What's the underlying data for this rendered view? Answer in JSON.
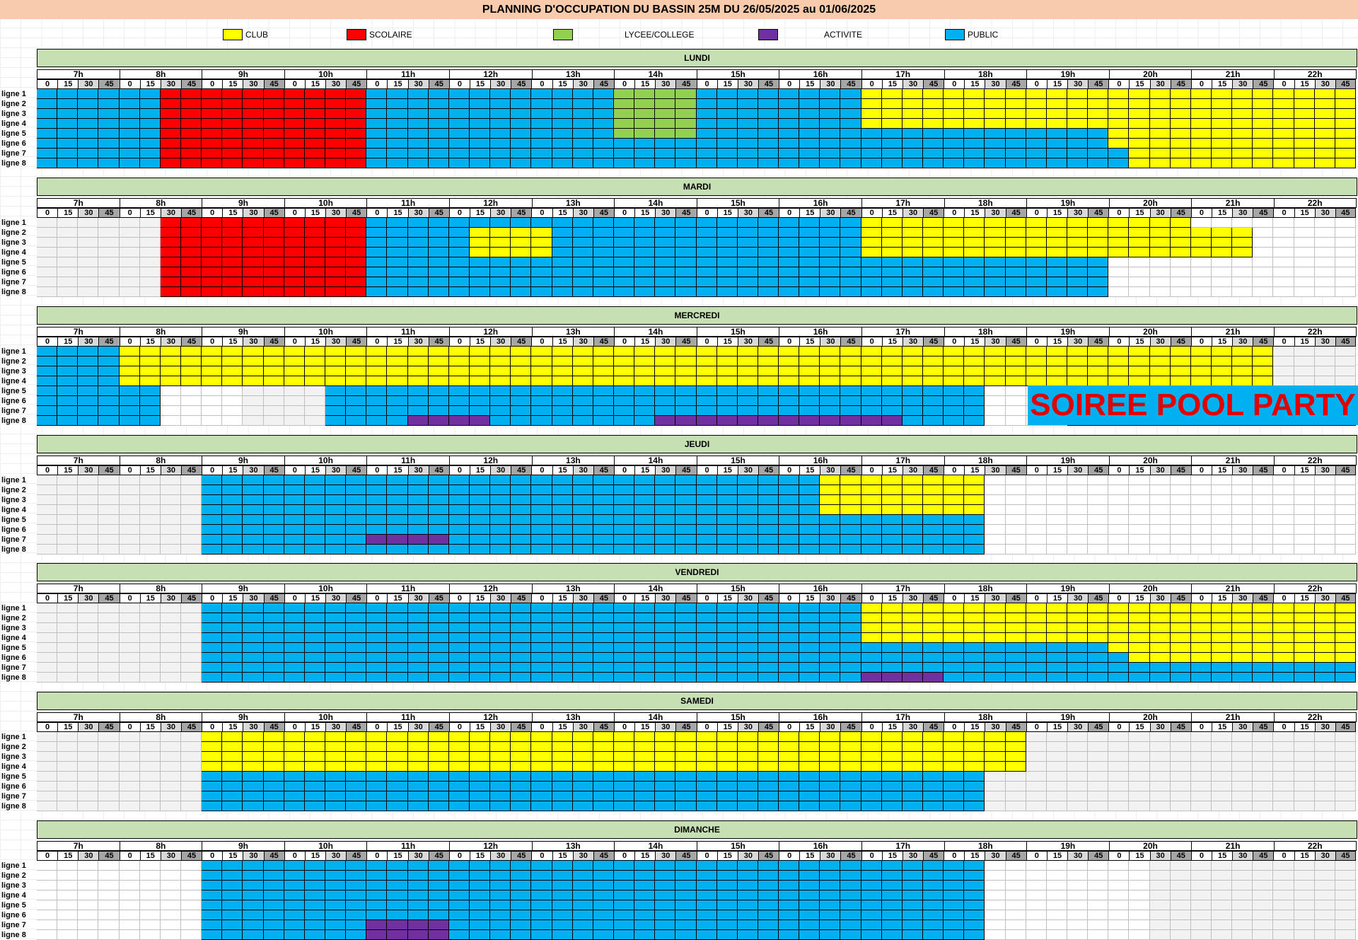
{
  "title": "PLANNING D'OCCUPATION DU BASSIN 25M DU 26/05/2025 au 01/06/2025",
  "legend": [
    {
      "code": "C",
      "label": "CLUB",
      "color": "#FFFF00"
    },
    {
      "code": "S",
      "label": "SCOLAIRE",
      "color": "#FF0000"
    },
    {
      "code": "L",
      "label": "LYCEE/COLLEGE",
      "color": "#92D050"
    },
    {
      "code": "A",
      "label": "ACTIVITE",
      "color": "#7030A0"
    },
    {
      "code": "P",
      "label": "PUBLIC",
      "color": "#00B0F0"
    }
  ],
  "hours": [
    "7h",
    "8h",
    "9h",
    "10h",
    "11h",
    "12h",
    "13h",
    "14h",
    "15h",
    "16h",
    "17h",
    "18h",
    "19h",
    "20h",
    "21h",
    "22h"
  ],
  "quarters": [
    "0",
    "15",
    "30",
    "45"
  ],
  "lines": [
    "ligne 1",
    "ligne 2",
    "ligne 3",
    "ligne 4",
    "ligne 5",
    "ligne 6",
    "ligne 7",
    "ligne 8"
  ],
  "days": [
    {
      "name": "LUNDI",
      "rows": [
        "PPPPPPSSSSSSSSSSPPPPPPPPPPPPLLLLPPPPPPPPCCCCCCCCCCCCCCCCCCCCCCCCnnnnnnnn",
        "PPPPPPSSSSSSSSSSPPPPPPPPPPPPLLLLPPPPPPPPCCCCCCCCCCCCCCCCCCCCCCCCnnnnnnnn",
        "PPPPPPSSSSSSSSSSPPPPPPPPPPPPLLLLPPPPPPPPCCCCCCCCCCCCCCCCCCCCCCCCnnnnnnnn",
        "PPPPPPSSSSSSSSSSPPPPPPPPPPPPLLLLPPPPPPPPCCCCCCCCCCCCCCCCCCCCCCCCnnnnnnnn",
        "PPPPPPSSSSSSSSSSPPPPPPPPPPPPLLLLPPPPPPPPPPPPPPPPPPPPCCCCCCCCCCCCnnnnnnnn",
        "PPPPPPSSSSSSSSSSPPPPPPPPPPPPPPPPPPPPPPPPPPPPPPPPPPPPCCCCCCCCCCCCnnnnnnnn",
        "PPPPPPSSSSSSSSSSPPPPPPPPPPPPPPPPPPPPPPPPPPPPPPPPPPPPPCCCCCCCCCCCnnnnnnnn",
        "PPPPPPSSSSSSSSSSPPPPPPPPPPPPPPPPPPPPPPPPPPPPPPPPPPPPPCCCCCCCCCCCnnnnnnnn"
      ]
    },
    {
      "name": "MARDI",
      "rows": [
        "nnnnnnSSSSSSSSSSPPPPPPPPPPPPPPPPPPPPPPPPCCCCCCCCCCCCCCCCeeeeeeeeeeeeeeee",
        "nnnnnnSSSSSSSSSSPPPPPCCCCPPPPPPPPPPPPPPPCCCCCCCCCCCCCCCCCCCeeeeeeeeeeeee",
        "nnnnnnSSSSSSSSSSPPPPPCCCCPPPPPPPPPPPPPPPCCCCCCCCCCCCCCCCCCCeeeeeeeeeeeee",
        "nnnnnnSSSSSSSSSSPPPPPCCCCPPPPPPPPPPPPPPPCCCCCCCCCCCCCCCCCCCeeeeeeeeeeeee",
        "nnnnnnSSSSSSSSSSPPPPPPPPPPPPPPPPPPPPPPPPPPPPPPPPPPPPeeeeeeeeeeeeeeeeeeee",
        "nnnnnnSSSSSSSSSSPPPPPPPPPPPPPPPPPPPPPPPPPPPPPPPPPPPPeeeeeeeeeeeeeeeeeeee",
        "nnnnnnSSSSSSSSSSPPPPPPPPPPPPPPPPPPPPPPPPPPPPPPPPPPPPeeeeeeeeeeeeeeeeeeee",
        "nnnnnnSSSSSSSSSSPPPPPPPPPPPPPPPPPPPPPPPPPPPPPPPPPPPPeeeeeeeeeeeeeeeeeeee"
      ]
    },
    {
      "name": "MERCREDI",
      "rows": [
        "PPPPCCCCCCCCCCCCCCCCCCCCCCCCCCCCCCCCCCCCCCCCCCCCCCCCCCCCCCCCnnnnnnnn",
        "PPPPCCCCCCCCCCCCCCCCCCCCCCCCCCCCCCCCCCCCCCCCCCCCCCCCCCCCCCCCnnnnnnnn",
        "PPPPCCCCCCCCCCCCCCCCCCCCCCCCCCCCCCCCCCCCCCCCCCCCCCCCCCCCCCCCnnnnnnnn",
        "PPPPCCCCCCCCCCCCCCCCCCCCCCCCCCCCCCCCCCCCCCCCCCCCCCCCCCCCCCCCnnnnnnnn",
        "PPPPPPeeeennnnPPPPPPPPPPPPPPPPPPPPPPPPPPPPPPPPeeeePPPPPPPPPPPPPPPPPP",
        "PPPPPPeeeennnnPPPPPPPPPPPPPPPPPPPPPPPPPPPPPPPPeeeePPPPPPPPPPPPPPPPPP",
        "PPPPPPeeeennnnPPPPPPPPPPPPPPPPPPPPPPPPPPPPPPPPeeeePPPPPPPPPPPPPPPPPP",
        "PPPPPPeeeennnnPPPPAAAAPPPPPPPPAAAAAAAAAAAAPPPPeeeePPPPPPPPPPPPPPPPPP"
      ]
    },
    {
      "name": "JEUDI",
      "rows": [
        "nnnnnnnnPPPPPPPPPPPPPPPPPPPPPPPPPPPPPPCCCCCCCCeeeeeeeeeeeeeeeeeeeeeeeee",
        "nnnnnnnnPPPPPPPPPPPPPPPPPPPPPPPPPPPPPPCCCCCCCCeeeeeeeeeeeeeeeeeeeeeeeee",
        "nnnnnnnnPPPPPPPPPPPPPPPPPPPPPPPPPPPPPPCCCCCCCCeeeeeeeeeeeeeeeeeeeeeeeee",
        "nnnnnnnnPPPPPPPPPPPPPPPPPPPPPPPPPPPPPPCCCCCCCCeeeeeeeeeeeeeeeeeeeeeeeee",
        "nnnnnnnnPPPPPPPPPPPPPPPPPPPPPPPPPPPPPPPPPPPPPPeeeeeeeeeeeeeeeeeeeeeeeee",
        "nnnnnnnnPPPPPPPPPPPPPPPPPPPPPPPPPPPPPPPPPPPPPPeeeeeeeeeeeeeeeeeeeeeeeee",
        "nnnnnnnnPPPPPPPPAAAAPPPPPPPPPPPPPPPPPPPPPPPPPPeeeeeeeeeeeeeeeeeeeeeeeee",
        "nnnnnnnnPPPPPPPPPPPPPPPPPPPPPPPPPPPPPPPPPPPPPPeeeeeeeeeeeeeeeeeeeeeeeee"
      ]
    },
    {
      "name": "VENDREDI",
      "rows": [
        "nnnnnnnnPPPPPPPPPPPPPPPPPPPPPPPPPPPPPPPPCCCCCCCCCCCCCCCCCCCCCCCCCnnnnnnn",
        "nnnnnnnnPPPPPPPPPPPPPPPPPPPPPPPPPPPPPPPPCCCCCCCCCCCCCCCCCCCCCCCCCnnnnnnn",
        "nnnnnnnnPPPPPPPPPPPPPPPPPPPPPPPPPPPPPPPPCCCCCCCCCCCCCCCCCCCCCCCCCnnnnnnn",
        "nnnnnnnnPPPPPPPPPPPPPPPPPPPPPPPPPPPPPPPPCCCCCCCCCCCCCCCCCCCCCCCCCnnnnnnn",
        "nnnnnnnnPPPPPPPPPPPPPPPPPPPPPPPPPPPPPPPPPPPPPPPPPPPPCCCCCCCCCCCCCnnnnnnn",
        "nnnnnnnnPPPPPPPPPPPPPPPPPPPPPPPPPPPPPPPPPPPPPPPPPPPPPCCCCCCCCCCCCnnnnnnn",
        "nnnnnnnnPPPPPPPPPPPPPPPPPPPPPPPPPPPPPPPPPPPPPPPPPPPPPPPPPPPPPPPPennnnnnn",
        "nnnnnnnnPPPPPPPPPPPPPPPPPPPPPPPPPPPPPPPPAAAAPPPPPPPPPPPPPPPPPPPPPnnnnnnn"
      ]
    },
    {
      "name": "SAMEDI",
      "rows": [
        "nnnnnnnnCCCCCCCCCCCCCCCCCCCCCCCCCCCCCCCCCCCCCCCCnnnnnnnnnnnnnnnn",
        "nnnnnnnnCCCCCCCCCCCCCCCCCCCCCCCCCCCCCCCCCCCCCCCCnnnnnnnnnnnnnnnn",
        "nnnnnnnnCCCCCCCCCCCCCCCCCCCCCCCCCCCCCCCCCCCCCCCCnnnnnnnnnnnnnnnn",
        "nnnnnnnnCCCCCCCCCCCCCCCCCCCCCCCCCCCCCCCCCCCCCCCCnnnnnnnnnnnnnnnn",
        "nnnnnnnnPPPPPPPPPPPPPPPPPPPPPPPPPPPPPPPPPPPPPPnnnnnnnnnnnnnnnnnnnn",
        "nnnnnnnnPPPPPPPPPPPPPPPPPPPPPPPPPPPPPPPPPPPPPPnnnnnnnnnnnnnnnnnnnn",
        "nnnnnnnnPPPPPPPPPPPPPPPPPPPPPPPPPPPPPPPPPPPPPPnnnnnnnnnnnnnnnnnnnn",
        "nnnnnnnnPPPPPPPPPPPPPPPPPPPPPPPPPPPPPPPPPPPPPPnnnnnnnnnnnnnnnnnnnn"
      ]
    },
    {
      "name": "DIMANCHE",
      "rows": [
        "eeeeeeeePPPPPPPPPPPPPPPPPPPPPPPPPPPPPPPPPPPPPPeeeeeeeennnnnnnnnnnn",
        "eeeeeeeePPPPPPPPPPPPPPPPPPPPPPPPPPPPPPPPPPPPPPeeeeeeeennnnnnnnnnnn",
        "eeeeeeeePPPPPPPPPPPPPPPPPPPPPPPPPPPPPPPPPPPPPPeeeeeeeennnnnnnnnnnn",
        "eeeeeeeePPPPPPPPPPPPPPPPPPPPPPPPPPPPPPPPPPPPPPeeeeeeeennnnnnnnnnnn",
        "eeeeeeeePPPPPPPPPPPPPPPPPPPPPPPPPPPPPPPPPPPPPPeeeeeeeennnnnnnnnnnn",
        "eeeeeeeePPPPPPPPPPPPPPPPPPPPPPPPPPPPPPPPPPPPPPeeeeeeeennnnnnnnnnnn",
        "eeeeeeeePPPPPPPPAAAAPPPPPPPPPPPPPPPPPPPPPPPPPPeeeeeeeennnnnnnnnnnn",
        "eeeeeeeePPPPPPPPAAAAPPPPPPPPPPPPPPPPPPPPPPPPPPeeeeeeeennnnnnnnnnnn"
      ]
    }
  ],
  "pool_party": "SOIREE POOL PARTY"
}
